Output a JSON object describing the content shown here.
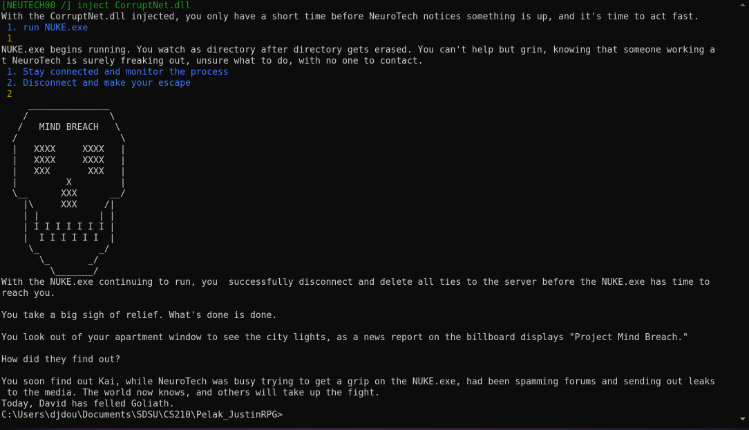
{
  "terminal": {
    "lines": [
      "[NEUTECH00 /] inject CorruptNet.dll",
      "With the CorruptNet.dll injected, you only have a short time before NeuroTech notices something is up, and it's time to act fast.",
      " 1. run NUKE.exe",
      " 1",
      "NUKE.exe begins running. You watch as directory after directory gets erased. You can't help but grin, knowing that someone working a",
      "t NeuroTech is surely freaking out, unsure what to do, with no one to contact.",
      " 1. Stay connected and monitor the process",
      " 2. Disconnect and make your escape",
      " 2",
      "",
      "     _______________",
      "    /               \\",
      "   /   MIND BREACH   \\",
      "  /                   \\",
      "  |   XXXX     XXXX   |",
      "  |   XXXX     XXXX   |",
      "  |   XXX       XXX   |",
      "  |         X         |",
      "  \\__      XXX      __/",
      "    |\\     XXX     /|",
      "    | |           | |",
      "    | I I I I I I I |",
      "    |  I I I I I I  |",
      "     \\_           _/",
      "       \\_       _/",
      "         \\_______/",
      "With the NUKE.exe continuing to run, you  successfully disconnect and delete all ties to the server before the NUKE.exe has time to",
      "reach you.",
      "",
      "You take a big sigh of relief. What's done is done.",
      "",
      "You look out of your apartment window to see the city lights, as a news report on the billboard displays \"Project Mind Breach.\"",
      "",
      "How did they find out?",
      "",
      "You soon find out Kai, while NeuroTech was busy trying to get a grip on the NUKE.exe, had been spamming forums and sending out leaks",
      " to the media. The world now knows, and others will take up the fight.",
      "Today, David has felled Goliath.",
      "C:\\Users\\djdou\\Documents\\SDSU\\CS210\\Pelak_JustinRPG>"
    ]
  },
  "colors": {
    "background": "#0c0c0c",
    "text": "#cccccc",
    "prompt_green": "#13a10e",
    "option_blue": "#3b78ff",
    "input_orange": "#c19c00"
  },
  "scrollbar": {
    "up_icon": "triangle-up",
    "down_icon": "triangle-down"
  }
}
